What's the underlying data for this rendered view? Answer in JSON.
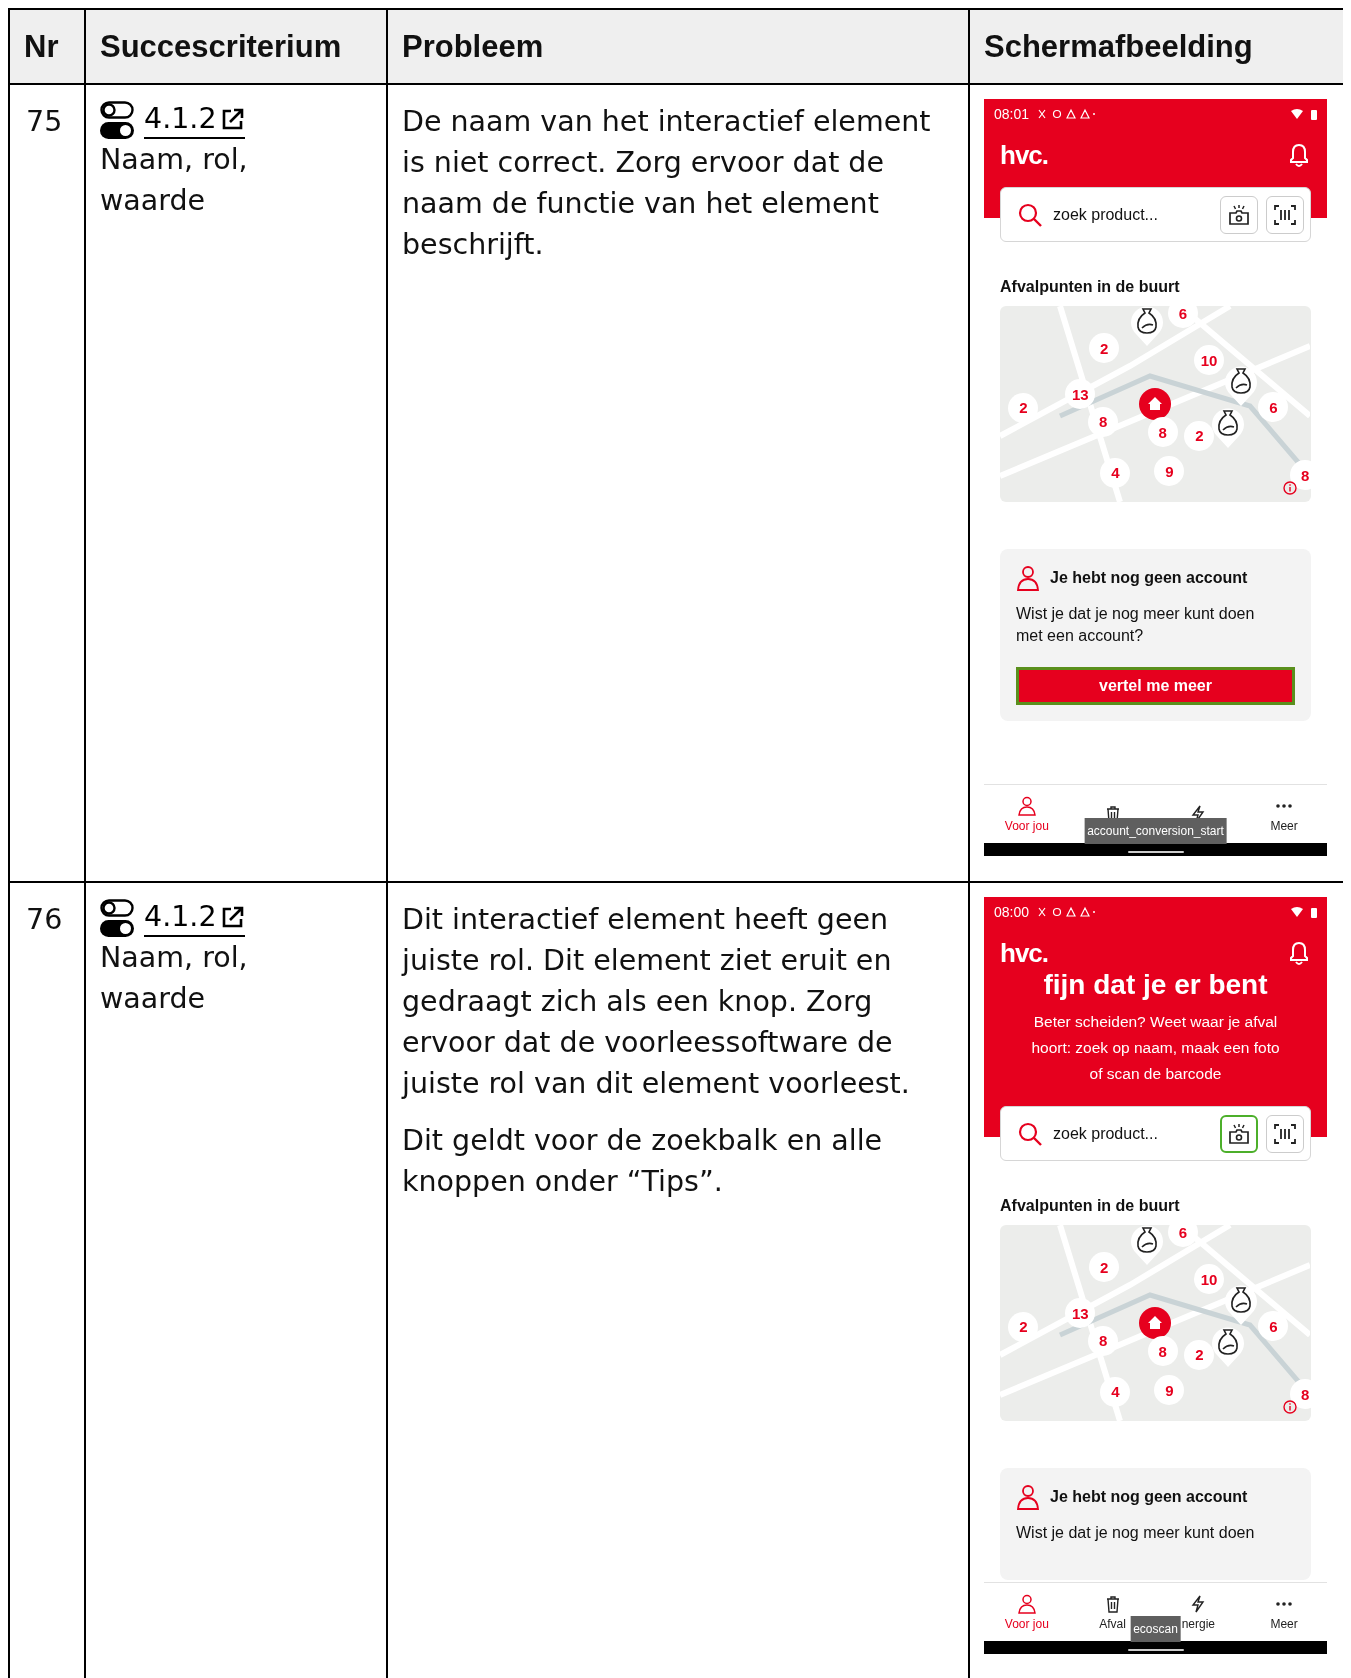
{
  "table": {
    "columns": [
      "Nr",
      "Succescriterium",
      "Probleem",
      "Schermafbeelding"
    ],
    "rows": [
      {
        "nr": "75",
        "criterion": {
          "number": "4.1.2",
          "name": "Naam, rol, waarde"
        },
        "problem": [
          "De naam van het interactief element is niet correct. Zorg ervoor dat de naam de functie van het element beschrijft."
        ],
        "screenshot": {
          "status_bar": {
            "time": "08:01"
          },
          "logo": "hvc.",
          "search": {
            "placeholder": "zoek product...",
            "camera_button": {
              "focused": false
            }
          },
          "map_section": {
            "title": "Afvalpunten in de buurt",
            "markers": [
              {
                "kind": "bag"
              },
              {
                "kind": "count",
                "label": "6"
              },
              {
                "kind": "count",
                "label": "2"
              },
              {
                "kind": "count",
                "label": "10"
              },
              {
                "kind": "bag"
              },
              {
                "kind": "count",
                "label": "13"
              },
              {
                "kind": "count",
                "label": "2"
              },
              {
                "kind": "home"
              },
              {
                "kind": "count",
                "label": "6"
              },
              {
                "kind": "count",
                "label": "8"
              },
              {
                "kind": "count",
                "label": "8"
              },
              {
                "kind": "count",
                "label": "2"
              },
              {
                "kind": "bag"
              },
              {
                "kind": "count",
                "label": "4"
              },
              {
                "kind": "count",
                "label": "9"
              },
              {
                "kind": "count",
                "label": "8"
              },
              {
                "kind": "info"
              }
            ]
          },
          "account_card": {
            "title": "Je hebt nog geen account",
            "text": "Wist je dat je nog meer kunt doen met een account?",
            "button": {
              "label": "vertel me meer",
              "focused": true
            }
          },
          "nav": [
            {
              "kind": "person",
              "label": "Voor jou",
              "selected": true
            },
            {
              "kind": "trash",
              "selected": false
            },
            {
              "kind": "bolt",
              "selected": false
            },
            {
              "kind": "more",
              "label": "Meer",
              "selected": false
            }
          ],
          "tooltip": "account_conversion_start"
        }
      },
      {
        "nr": "76",
        "criterion": {
          "number": "4.1.2",
          "name": "Naam, rol, waarde"
        },
        "problem": [
          "Dit interactief element heeft geen juiste rol. Dit element ziet eruit en gedraagt zich als een knop. Zorg ervoor dat de voorleessoftware de juiste rol van dit element voorleest.",
          "Dit geldt voor de zoekbalk en alle knoppen onder “Tips”."
        ],
        "screenshot": {
          "status_bar": {
            "time": "08:00"
          },
          "logo": "hvc.",
          "hero": {
            "title": "fijn dat je er bent",
            "text": "Beter scheiden? Weet waar je afval hoort: zoek op naam, maak een foto of scan de barcode"
          },
          "search": {
            "placeholder": "zoek product...",
            "camera_button": {
              "focused": true
            }
          },
          "map_section": {
            "title": "Afvalpunten in de buurt",
            "markers": [
              {
                "kind": "bag"
              },
              {
                "kind": "count",
                "label": "6"
              },
              {
                "kind": "count",
                "label": "2"
              },
              {
                "kind": "count",
                "label": "10"
              },
              {
                "kind": "bag"
              },
              {
                "kind": "count",
                "label": "13"
              },
              {
                "kind": "count",
                "label": "2"
              },
              {
                "kind": "home"
              },
              {
                "kind": "count",
                "label": "6"
              },
              {
                "kind": "count",
                "label": "8"
              },
              {
                "kind": "count",
                "label": "8"
              },
              {
                "kind": "count",
                "label": "2"
              },
              {
                "kind": "bag"
              },
              {
                "kind": "count",
                "label": "4"
              },
              {
                "kind": "count",
                "label": "9"
              },
              {
                "kind": "count",
                "label": "8"
              },
              {
                "kind": "info"
              }
            ]
          },
          "account_card": {
            "title": "Je hebt nog geen account",
            "text": "Wist je dat je nog meer kunt doen"
          },
          "nav": [
            {
              "kind": "person",
              "label": "Voor jou",
              "selected": true
            },
            {
              "kind": "trash",
              "label": "Afval",
              "selected": false
            },
            {
              "kind": "bolt",
              "label": "nergie",
              "selected": false
            },
            {
              "kind": "more",
              "label": "Meer",
              "selected": false
            }
          ],
          "tooltip": "ecoscan"
        }
      }
    ]
  }
}
